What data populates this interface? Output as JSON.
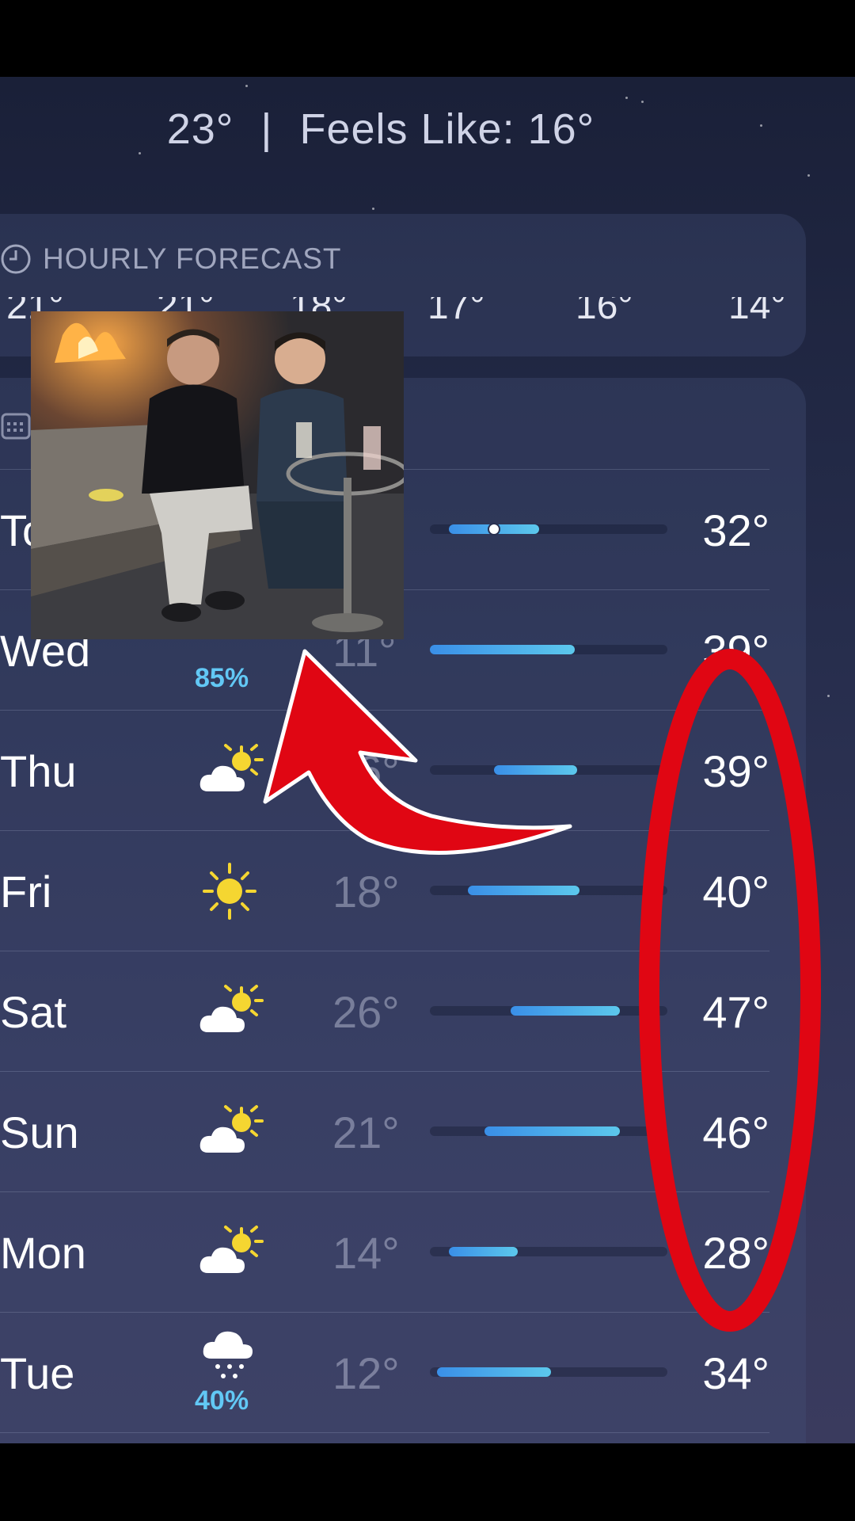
{
  "header": {
    "current_temp": "23°",
    "separator": "|",
    "feels_like": "Feels Like: 16°"
  },
  "hourly": {
    "title": "HOURLY FORECAST",
    "temps": [
      "21°",
      "21°",
      "18°",
      "17°",
      "16°",
      "14°"
    ]
  },
  "daily": {
    "days": [
      {
        "day": "To",
        "low": "",
        "high": "32°",
        "range": [
          0.08,
          0.46
        ],
        "current": 0.27,
        "icon": "none",
        "precip": ""
      },
      {
        "day": "Wed",
        "low": "11°",
        "high": "39°",
        "range": [
          0.0,
          0.61
        ],
        "current": null,
        "icon": "snow-icon",
        "precip": "85%"
      },
      {
        "day": "Thu",
        "low": "16°",
        "high": "39°",
        "range": [
          0.27,
          0.62
        ],
        "current": null,
        "icon": "partly-sunny-icon",
        "precip": ""
      },
      {
        "day": "Fri",
        "low": "18°",
        "high": "40°",
        "range": [
          0.16,
          0.63
        ],
        "current": null,
        "icon": "sun-icon",
        "precip": ""
      },
      {
        "day": "Sat",
        "low": "26°",
        "high": "47°",
        "range": [
          0.34,
          0.8
        ],
        "current": null,
        "icon": "partly-sunny-icon",
        "precip": ""
      },
      {
        "day": "Sun",
        "low": "21°",
        "high": "46°",
        "range": [
          0.23,
          0.8
        ],
        "current": null,
        "icon": "partly-sunny-icon",
        "precip": ""
      },
      {
        "day": "Mon",
        "low": "14°",
        "high": "28°",
        "range": [
          0.08,
          0.37
        ],
        "current": null,
        "icon": "partly-sunny-icon",
        "precip": ""
      },
      {
        "day": "Tue",
        "low": "12°",
        "high": "34°",
        "range": [
          0.03,
          0.51
        ],
        "current": null,
        "icon": "snow-cloud-icon",
        "precip": "40%"
      }
    ]
  },
  "colors": {
    "cold": "#3a8fe8",
    "cool": "#5cc8ec",
    "precip": "#62c8f5",
    "annotation_red": "#e00613"
  }
}
